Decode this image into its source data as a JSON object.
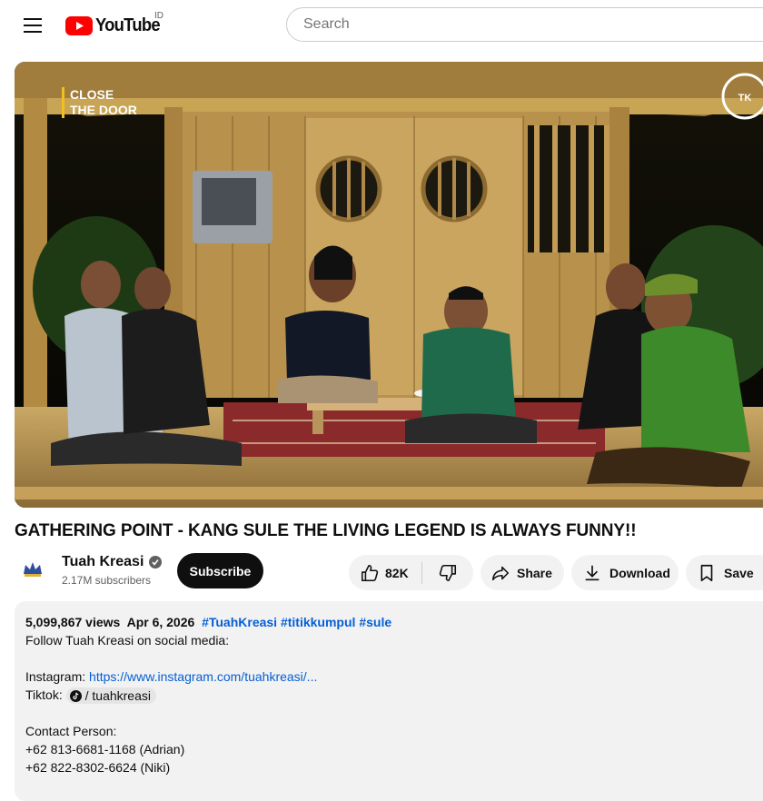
{
  "header": {
    "logo_text": "YouTube",
    "region": "ID",
    "search_placeholder": "Search"
  },
  "player": {
    "overlay_line1": "CLOSE",
    "overlay_line2": "THE DOOR",
    "watermark_icon": "channel-watermark-icon"
  },
  "video": {
    "title": "GATHERING POINT - KANG SULE THE LIVING LEGEND IS ALWAYS FUNNY!!"
  },
  "channel": {
    "name": "Tuah Kreasi",
    "subscribers": "2.17M subscribers",
    "subscribe_label": "Subscribe"
  },
  "actions": {
    "likes": "82K",
    "share": "Share",
    "download": "Download",
    "save": "Save"
  },
  "description": {
    "views": "5,099,867 views",
    "date": "Apr 6, 2026",
    "hashtags": [
      "#TuahKreasi",
      "#titikkumpul",
      "#sule"
    ],
    "intro": "Follow Tuah Kreasi on social media:",
    "instagram_label": "Instagram:",
    "instagram_url": "https://www.instagram.com/tuahkreasi/...",
    "tiktok_label": "Tiktok:",
    "tiktok_handle": "/ tuahkreasi",
    "contact_label": "Contact Person:",
    "phone_1": "+62 813-6681-1168 (Adrian)",
    "phone_2": "+62 822-8302-6624 (Niki)"
  },
  "colors": {
    "brand_red": "#ff0000",
    "link_blue": "#065fd4",
    "pill_bg": "#f2f2f2",
    "subscribe_bg": "#0f0f0f"
  }
}
